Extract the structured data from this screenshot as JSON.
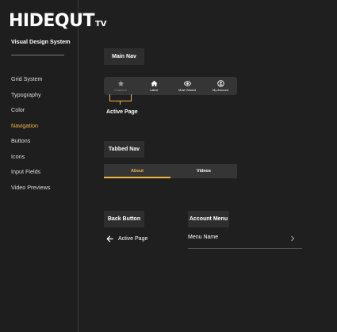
{
  "sidebar": {
    "logo": "HIDEQUT",
    "logo_suffix": "TV",
    "subtitle": "Visual Design System",
    "items": [
      {
        "label": "Grid System"
      },
      {
        "label": "Typography"
      },
      {
        "label": "Color"
      },
      {
        "label": "Navigation",
        "active": true
      },
      {
        "label": "Buttons"
      },
      {
        "label": "Icons"
      },
      {
        "label": "Input Fields"
      },
      {
        "label": "Video Previews"
      }
    ]
  },
  "main_nav_section": {
    "title": "Main Nav",
    "items": [
      {
        "label": "Featured",
        "icon": "star-icon",
        "active": true
      },
      {
        "label": "Latest",
        "icon": "home-icon"
      },
      {
        "label": "Most Viewed",
        "icon": "eye-icon"
      },
      {
        "label": "My Account",
        "icon": "user-icon"
      }
    ],
    "caption": "Active Page"
  },
  "tabbed_nav_section": {
    "title": "Tabbed Nav",
    "tabs": [
      {
        "label": "About",
        "active": true
      },
      {
        "label": "Videos"
      }
    ]
  },
  "back_button_section": {
    "title": "Back Button",
    "back_label": "Active Page",
    "icon": "arrow-left-icon"
  },
  "account_menu_section": {
    "title": "Account Menu",
    "row_label": "Menu Name",
    "icon": "chevron-right-icon"
  },
  "colors": {
    "accent": "#f0b845",
    "background": "#1f1f1f",
    "surface": "#353535"
  }
}
